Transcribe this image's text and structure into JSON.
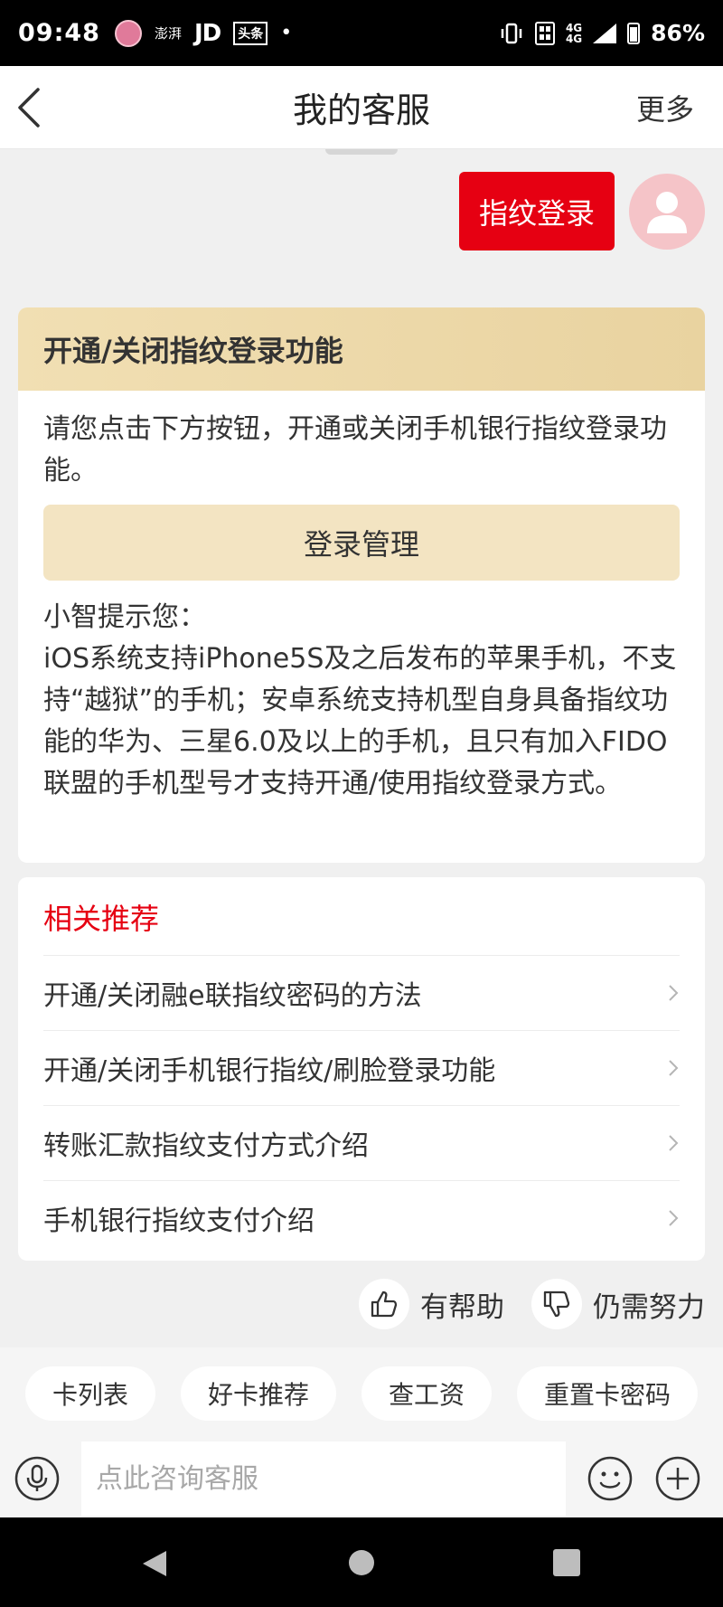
{
  "status_bar": {
    "time": "09:48",
    "app_1": "澎湃",
    "app_jd": "JD",
    "app_toutiao": "头条",
    "network_top": "4G",
    "network_bottom": "4G",
    "battery": "86%"
  },
  "header": {
    "title": "我的客服",
    "more_label": "更多",
    "back_icon": "chevron-left-icon"
  },
  "conversation": {
    "user_message": "指纹登录"
  },
  "answer_card": {
    "title": "开通/关闭指纹登录功能",
    "description": "请您点击下方按钮，开通或关闭手机银行指纹登录功能。",
    "button_label": "登录管理",
    "tips_title": "小智提示您：",
    "tips_body": "iOS系统支持iPhone5S及之后发布的苹果手机，不支持“越狱”的手机；安卓系统支持机型自身具备指纹功能的华为、三星6.0及以上的手机，且只有加入FIDO联盟的手机型号才支持开通/使用指纹登录方式。"
  },
  "related": {
    "title": "相关推荐",
    "items": [
      {
        "label": "开通/关闭融e联指纹密码的方法"
      },
      {
        "label": "开通/关闭手机银行指纹/刷脸登录功能"
      },
      {
        "label": "转账汇款指纹支付方式介绍"
      },
      {
        "label": "手机银行指纹支付介绍"
      }
    ]
  },
  "feedback": {
    "helpful_label": "有帮助",
    "not_helpful_label": "仍需努力"
  },
  "quick_chips": [
    {
      "label": "卡列表"
    },
    {
      "label": "好卡推荐"
    },
    {
      "label": "查工资"
    },
    {
      "label": "重置卡密码"
    }
  ],
  "input": {
    "placeholder": "点此咨询客服",
    "value": ""
  },
  "colors": {
    "accent_red": "#e60012",
    "gold_header": "#ecd7a6",
    "button_gold": "#f3e4c2"
  }
}
